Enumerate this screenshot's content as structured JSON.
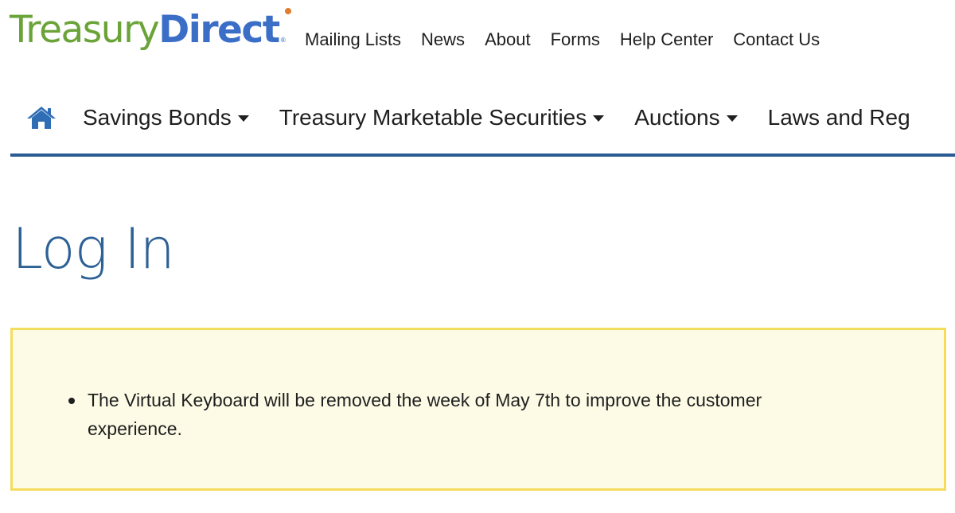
{
  "logo": {
    "part1": "Treasury",
    "part2": "Direct",
    "reg": "®",
    "colors": {
      "treasury": "#6aa338",
      "direct": "#3a6ec7",
      "accent": "#e07d2e"
    }
  },
  "utility_nav": {
    "items": [
      {
        "label": "Mailing Lists"
      },
      {
        "label": "News"
      },
      {
        "label": "About"
      },
      {
        "label": "Forms"
      },
      {
        "label": "Help Center"
      },
      {
        "label": "Contact Us"
      }
    ]
  },
  "main_nav": {
    "home_icon": "home-icon",
    "items": [
      {
        "label": "Savings Bonds",
        "dropdown": true
      },
      {
        "label": "Treasury Marketable Securities",
        "dropdown": true
      },
      {
        "label": "Auctions",
        "dropdown": true
      },
      {
        "label": "Laws and Reg",
        "dropdown": false
      }
    ],
    "rule_color": "#2a5b92"
  },
  "page": {
    "title": "Log In",
    "title_color": "#2d6196"
  },
  "notice": {
    "items": [
      {
        "text": "The Virtual Keyboard will be removed the week of May 7th to improve the customer experience."
      }
    ],
    "background": "#fdfbe6",
    "border": "#f4dc5c"
  }
}
